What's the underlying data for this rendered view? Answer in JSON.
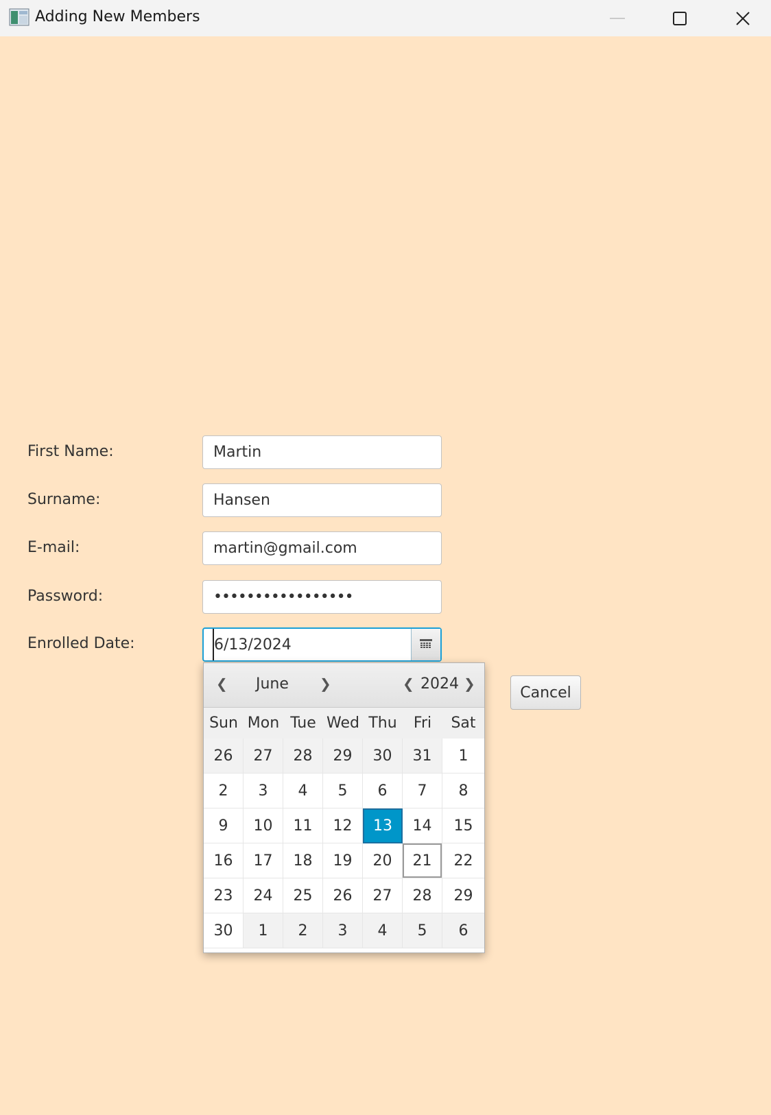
{
  "window": {
    "title": "Adding New Members"
  },
  "form": {
    "first_name_label": "First Name:",
    "first_name_value": "Martin",
    "surname_label": "Surname:",
    "surname_value": "Hansen",
    "email_label": "E-mail:",
    "email_value": "martin@gmail.com",
    "password_label": "Password:",
    "password_mask": "•••••••••••••••••",
    "enrolled_label": "Enrolled Date:",
    "enrolled_value": "6/13/2024",
    "cancel_label": "Cancel"
  },
  "calendar": {
    "month": "June",
    "year": "2024",
    "weekdays": [
      "Sun",
      "Mon",
      "Tue",
      "Wed",
      "Thu",
      "Fri",
      "Sat"
    ],
    "weeks": [
      [
        "26",
        "27",
        "28",
        "29",
        "30",
        "31",
        "1"
      ],
      [
        "2",
        "3",
        "4",
        "5",
        "6",
        "7",
        "8"
      ],
      [
        "9",
        "10",
        "11",
        "12",
        "13",
        "14",
        "15"
      ],
      [
        "16",
        "17",
        "18",
        "19",
        "20",
        "21",
        "22"
      ],
      [
        "23",
        "24",
        "25",
        "26",
        "27",
        "28",
        "29"
      ],
      [
        "30",
        "1",
        "2",
        "3",
        "4",
        "5",
        "6"
      ]
    ],
    "selected_day": "13",
    "today_day": "21"
  }
}
